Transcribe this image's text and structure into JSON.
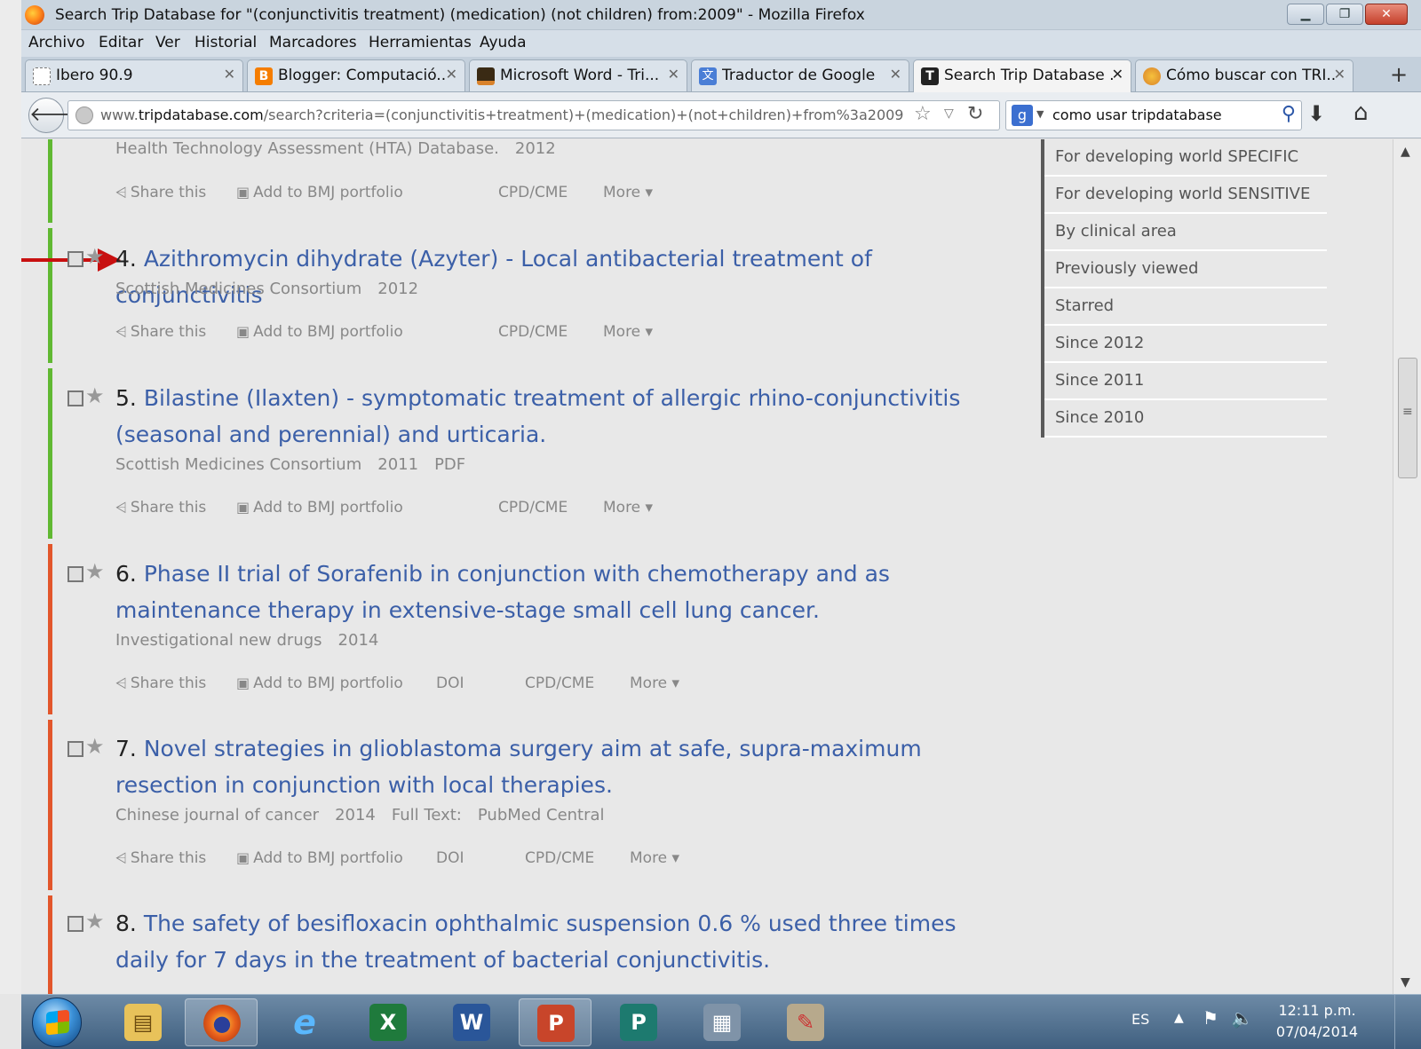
{
  "window": {
    "title": "Search Trip Database for \"(conjunctivitis treatment) (medication) (not children) from:2009\" - Mozilla Firefox"
  },
  "menu": [
    "Archivo",
    "Editar",
    "Ver",
    "Historial",
    "Marcadores",
    "Herramientas",
    "Ayuda"
  ],
  "tabs": [
    {
      "label": "Ibero 90.9",
      "icon": "page-icon",
      "color": "#ffffff"
    },
    {
      "label": "Blogger: Computació...",
      "icon": "blogger-icon",
      "color": "#f57d00"
    },
    {
      "label": "Microsoft Word - Tri...",
      "icon": "uic-icon",
      "color": "#d9822b"
    },
    {
      "label": "Traductor de Google",
      "icon": "translate-icon",
      "color": "#4a7ed6"
    },
    {
      "label": "Search Trip Database ...",
      "icon": "trip-icon",
      "color": "#222222"
    },
    {
      "label": "Cómo buscar con TRI...",
      "icon": "page-icon",
      "color": "#e8a33a"
    }
  ],
  "nav": {
    "url_host": "www.tripdatabase.com",
    "url_host_bold": "tripdatabase.com",
    "url_prefix": "www.",
    "url_path": "/search?criteria=(conjunctivitis+treatment)+(medication)+(not+children)+from%3a2009",
    "search_query": "como usar tripdatabase",
    "search_engine": "g"
  },
  "partial_top": {
    "meta": [
      "Health Technology Assessment (HTA) Database.",
      "2012"
    ],
    "actions": [
      "Share this",
      "Add to BMJ portfolio",
      "CPD/CME",
      "More"
    ]
  },
  "results": [
    {
      "num": "4.",
      "title": "Azithromycin dihydrate (Azyter) - Local antibacterial treatment of conjunctivitis",
      "meta": [
        "Scottish Medicines Consortium",
        "2012"
      ],
      "actions": [
        "Share this",
        "Add to BMJ portfolio",
        "CPD/CME",
        "More"
      ],
      "bar": "green"
    },
    {
      "num": "5.",
      "title": "Bilastine (Ilaxten) - symptomatic treatment of allergic rhino-conjunctivitis (seasonal and perennial) and urticaria.",
      "meta": [
        "Scottish Medicines Consortium",
        "2011",
        "PDF"
      ],
      "actions": [
        "Share this",
        "Add to BMJ portfolio",
        "CPD/CME",
        "More"
      ],
      "bar": "green"
    },
    {
      "num": "6.",
      "title": "Phase II trial of Sorafenib in conjunction with chemotherapy and as maintenance therapy in extensive-stage small cell lung cancer.",
      "meta": [
        "Investigational new drugs",
        "2014"
      ],
      "actions": [
        "Share this",
        "Add to BMJ portfolio",
        "DOI",
        "CPD/CME",
        "More"
      ],
      "bar": "red"
    },
    {
      "num": "7.",
      "title": "Novel strategies in glioblastoma surgery aim at safe, supra-maximum resection in conjunction with local therapies.",
      "meta": [
        "Chinese journal of cancer",
        "2014",
        "Full Text:",
        "PubMed Central"
      ],
      "actions": [
        "Share this",
        "Add to BMJ portfolio",
        "DOI",
        "CPD/CME",
        "More"
      ],
      "bar": "red"
    },
    {
      "num": "8.",
      "title": "The safety of besifloxacin ophthalmic suspension 0.6 % used three times daily for 7 days in the treatment of bacterial conjunctivitis.",
      "bar": "red"
    }
  ],
  "sidebar": [
    "For developing world SPECIFIC",
    "For developing world SENSITIVE",
    "By clinical area",
    "Previously viewed",
    "Starred",
    "Since 2012",
    "Since 2011",
    "Since 2010"
  ],
  "taskbar": {
    "apps": [
      {
        "name": "explorer",
        "glyph": "▤",
        "color": "#e8c25a"
      },
      {
        "name": "firefox",
        "glyph": "●",
        "color": "#e8601c"
      },
      {
        "name": "internet-explorer",
        "glyph": "e",
        "color": "#2b8fd8"
      },
      {
        "name": "excel",
        "glyph": "X",
        "color": "#1f7a3c"
      },
      {
        "name": "word",
        "glyph": "W",
        "color": "#2a5699"
      },
      {
        "name": "powerpoint",
        "glyph": "P",
        "color": "#c8452a"
      },
      {
        "name": "publisher",
        "glyph": "P",
        "color": "#1d7a6f"
      },
      {
        "name": "calculator",
        "glyph": "▦",
        "color": "#7f93a8"
      },
      {
        "name": "paint",
        "glyph": "✎",
        "color": "#b7a98c"
      }
    ],
    "lang": "ES",
    "time": "12:11 p.m.",
    "date": "07/04/2014"
  },
  "colors": {
    "link": "#3b5fa8",
    "bar_green": "#60b832",
    "bar_red": "#e2562b",
    "arrow": "#c81010"
  }
}
